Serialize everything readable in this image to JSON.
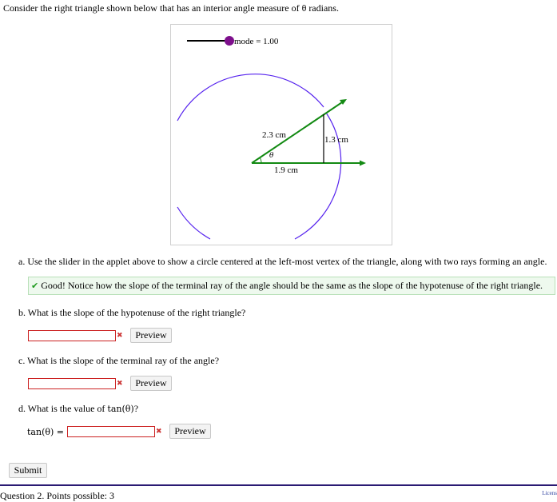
{
  "question": {
    "intro": "Consider the right triangle shown below that has an interior angle measure of θ radians."
  },
  "applet": {
    "slider_label": "mode = 1.00",
    "hypotenuse_label": "2.3 cm",
    "opposite_label": "1.3 cm",
    "adjacent_label": "1.9 cm",
    "angle_label": "θ",
    "colors": {
      "circle": "#5522ee",
      "rays": "#138a13",
      "slider_knob": "#7d0f8c",
      "triangle_side": "#000000"
    }
  },
  "part_a": {
    "text": "a. Use the slider in the applet above to show a circle centered at the left-most vertex of the triangle, along with two rays forming an angle.",
    "feedback": "Good! Notice how the slope of the terminal ray of the angle should be the same as the slope of the hypotenuse of the right triangle."
  },
  "part_b": {
    "text": "b. What is the slope of the hypotenuse of the right triangle?",
    "value": "",
    "preview_label": "Preview"
  },
  "part_c": {
    "text": "c. What is the slope of the terminal ray of the angle?",
    "value": "",
    "preview_label": "Preview"
  },
  "part_d": {
    "text_prefix": "d. What is the value of ",
    "text_math": "tan(θ)",
    "text_suffix": "?",
    "input_label": "tan(θ) =",
    "value": "",
    "preview_label": "Preview"
  },
  "submit_label": "Submit",
  "footer": {
    "question_info": "Question 2. Points possible: 3",
    "license": "Licens"
  }
}
